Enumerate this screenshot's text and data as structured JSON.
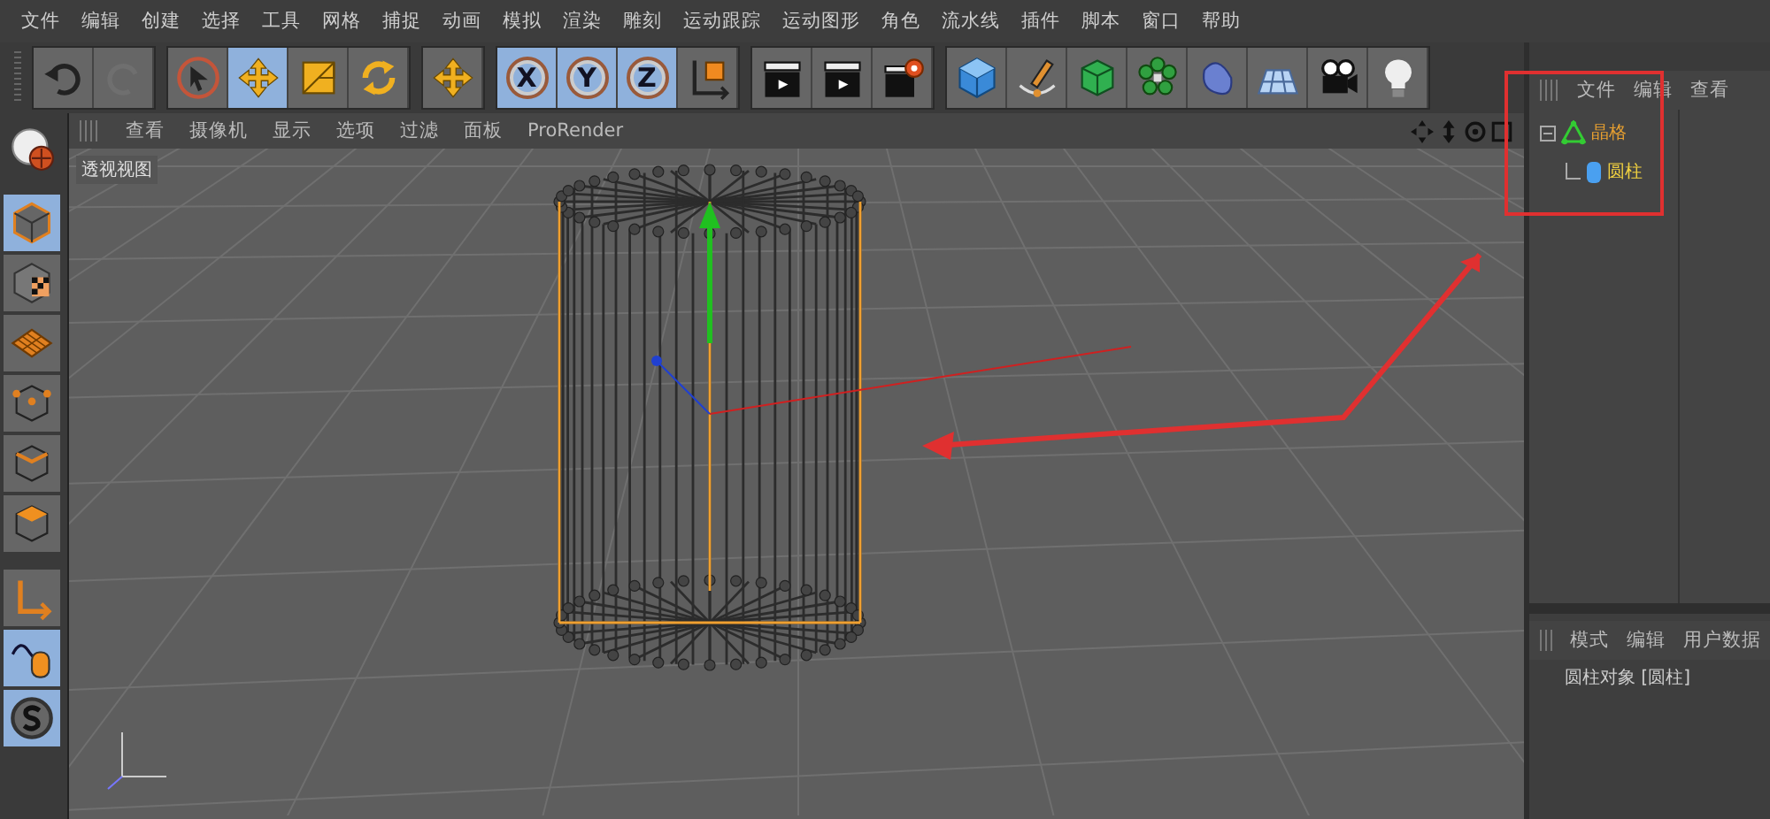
{
  "menu_bar": {
    "items": [
      "文件",
      "编辑",
      "创建",
      "选择",
      "工具",
      "网格",
      "捕捉",
      "动画",
      "模拟",
      "渲染",
      "雕刻",
      "运动跟踪",
      "运动图形",
      "角色",
      "流水线",
      "插件",
      "脚本",
      "窗口",
      "帮助"
    ]
  },
  "toolbar": {
    "groups": [
      {
        "items": [
          {
            "kind": "undo",
            "active": false
          },
          {
            "kind": "redo",
            "active": false
          }
        ]
      },
      {
        "items": [
          {
            "kind": "select",
            "active": false
          },
          {
            "kind": "move",
            "active": true
          },
          {
            "kind": "scale",
            "active": false
          },
          {
            "kind": "rotate",
            "active": false
          }
        ]
      },
      {
        "items": [
          {
            "kind": "move",
            "active": false
          }
        ]
      },
      {
        "items": [
          {
            "kind": "axis",
            "label": "X",
            "active": true
          },
          {
            "kind": "axis",
            "label": "Y",
            "active": true
          },
          {
            "kind": "axis",
            "label": "Z",
            "active": true
          },
          {
            "kind": "coord",
            "active": false
          }
        ]
      },
      {
        "items": [
          {
            "kind": "render",
            "active": false
          },
          {
            "kind": "render",
            "active": false
          },
          {
            "kind": "render-settings",
            "active": false
          }
        ]
      },
      {
        "items": [
          {
            "kind": "cube",
            "active": false
          },
          {
            "kind": "pen",
            "active": false
          },
          {
            "kind": "subdivision",
            "active": false
          },
          {
            "kind": "cloner",
            "active": false
          },
          {
            "kind": "deformer",
            "active": false
          },
          {
            "kind": "floor",
            "active": false
          },
          {
            "kind": "camera",
            "active": false
          },
          {
            "kind": "light",
            "active": false
          }
        ]
      }
    ]
  },
  "sidebar": {
    "items": [
      {
        "kind": "editable",
        "active": false
      },
      {
        "kind": "model",
        "active": true
      },
      {
        "kind": "texture",
        "active": false
      },
      {
        "kind": "workplane",
        "active": false
      },
      {
        "kind": "points",
        "active": false
      },
      {
        "kind": "edges",
        "active": false
      },
      {
        "kind": "polygons",
        "active": false
      },
      {
        "kind": "axis",
        "active": false
      },
      {
        "kind": "tweak",
        "active": true
      },
      {
        "kind": "snap",
        "active": true
      }
    ]
  },
  "viewport": {
    "menu": [
      "查看",
      "摄像机",
      "显示",
      "选项",
      "过滤",
      "面板",
      "ProRender"
    ],
    "label": "透视视图"
  },
  "object_manager": {
    "menu": [
      "文件",
      "编辑",
      "查看"
    ],
    "tree": [
      {
        "name": "晶格",
        "expanded": true,
        "children": [
          {
            "name": "圆柱"
          }
        ]
      }
    ]
  },
  "attribute_manager": {
    "menu": [
      "模式",
      "编辑",
      "用户数据"
    ],
    "title": "圆柱对象 [圆柱]"
  }
}
